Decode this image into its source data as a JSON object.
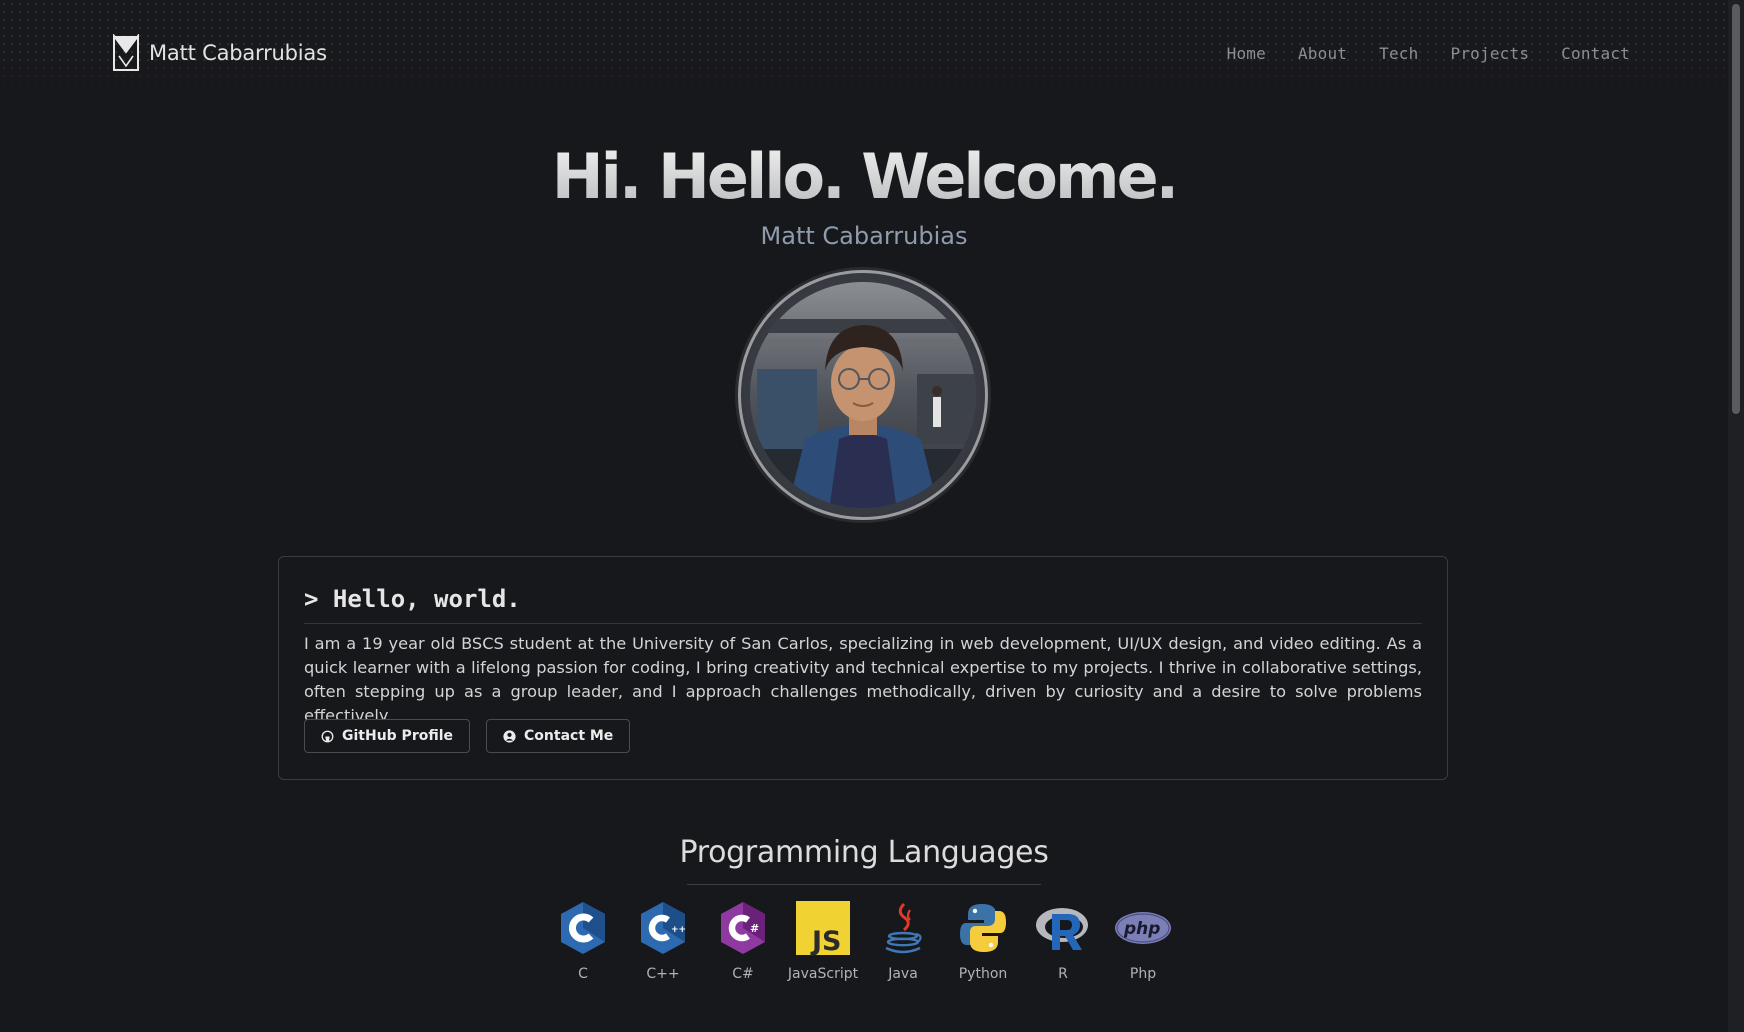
{
  "header": {
    "brand_name": "Matt Cabarrubias",
    "nav": [
      "Home",
      "About",
      "Tech",
      "Projects",
      "Contact"
    ]
  },
  "hero": {
    "title": "Hi. Hello. Welcome.",
    "subtitle": "Matt Cabarrubias"
  },
  "about": {
    "heading": "> Hello, world.",
    "body": "I am a 19 year old BSCS student at the University of San Carlos, specializing in web development, UI/UX design, and video editing. As a quick learner with a lifelong passion for coding, I bring creativity and technical expertise to my projects. I thrive in collaborative settings, often stepping up as a group leader, and I approach challenges methodically, driven by curiosity and a desire to solve problems effectively.",
    "buttons": {
      "github": "GitHub Profile",
      "contact": "Contact Me"
    }
  },
  "languages": {
    "title": "Programming Languages",
    "items": [
      {
        "label": "C",
        "icon": "c-language-icon"
      },
      {
        "label": "C++",
        "icon": "cpp-language-icon"
      },
      {
        "label": "C#",
        "icon": "csharp-language-icon"
      },
      {
        "label": "JavaScript",
        "icon": "javascript-icon"
      },
      {
        "label": "Java",
        "icon": "java-icon"
      },
      {
        "label": "Python",
        "icon": "python-icon"
      },
      {
        "label": "R",
        "icon": "r-language-icon"
      },
      {
        "label": "Php",
        "icon": "php-icon"
      }
    ]
  },
  "colors": {
    "background": "#17181b",
    "subtitle": "#8f9cae",
    "nav": "#8c8e92"
  }
}
